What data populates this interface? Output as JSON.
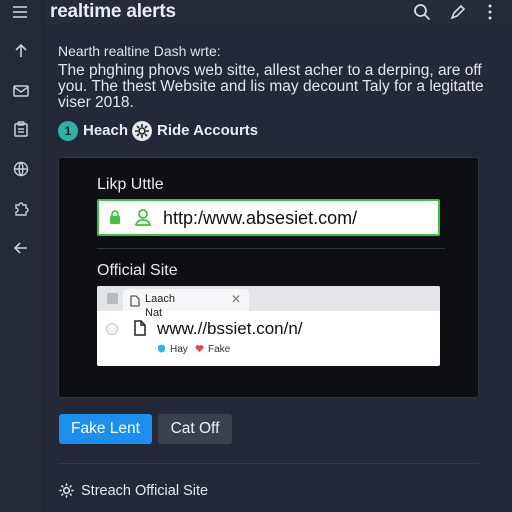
{
  "app": {
    "title": "realtime alerts"
  },
  "intro": {
    "title": "Nearth realtine Dash wrte:",
    "body": "The phghing phovs web sitte, allest acher to a derping, are off you. The thest Website and lis may decount Taly for a legitatte viser 2018."
  },
  "pills": [
    {
      "badge": "1",
      "label": "Heach"
    },
    {
      "badge": "",
      "label": "Ride Accourts"
    }
  ],
  "fake_section": {
    "label": "Likp Uttle",
    "url": "http:/www.absesiet.com/"
  },
  "official_section": {
    "label": "Official Site",
    "tab_title": "Laach",
    "new_tab": "Nat",
    "url": "www.//bssiet.con/n/",
    "tags": [
      {
        "label": "Hay",
        "color": "#2bb8e0"
      },
      {
        "label": "Fake",
        "color": "#e0425b"
      }
    ]
  },
  "actions": {
    "primary": "Fake Lent",
    "secondary": "Cat Off"
  },
  "footer": {
    "link": "Streach Official Site"
  },
  "colors": {
    "accent": "#1b8ff0",
    "success_border": "#3fbf45",
    "badge": "#2ab3a6",
    "background": "#232936",
    "panel": "#0d0f12"
  },
  "icons": {
    "rail": [
      "arrow-up-icon",
      "mail-icon",
      "clipboard-icon",
      "globe-icon",
      "puzzle-icon",
      "arrow-left-icon"
    ],
    "topbar": [
      "menu-icon",
      "search-icon",
      "edit-icon",
      "more-vertical-icon"
    ]
  }
}
